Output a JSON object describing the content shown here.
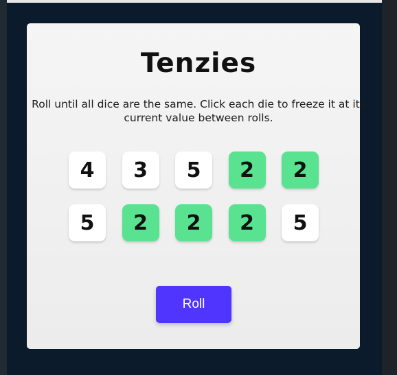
{
  "game": {
    "title": "Tenzies",
    "instructions": "Roll until all dice are the same. Click each die to freeze it at its current value between rolls.",
    "dice": [
      {
        "value": "4",
        "held": false
      },
      {
        "value": "3",
        "held": false
      },
      {
        "value": "5",
        "held": false
      },
      {
        "value": "2",
        "held": true
      },
      {
        "value": "2",
        "held": true
      },
      {
        "value": "5",
        "held": false
      },
      {
        "value": "2",
        "held": true
      },
      {
        "value": "2",
        "held": true
      },
      {
        "value": "2",
        "held": true
      },
      {
        "value": "5",
        "held": false
      }
    ],
    "roll_label": "Roll"
  },
  "colors": {
    "held_die": "#59e391",
    "free_die": "#ffffff",
    "roll_button": "#5035ff"
  }
}
